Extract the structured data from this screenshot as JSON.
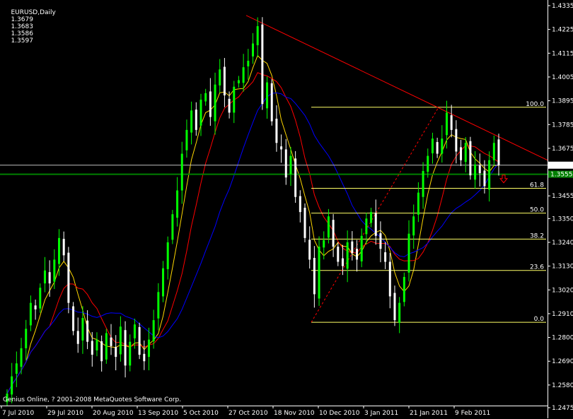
{
  "header": {
    "symbol": "EURUSD,Daily",
    "open": "1.3679",
    "high": "1.3683",
    "low": "1.3586",
    "close": "1.3597"
  },
  "footer": "Genius Online, ? 2001-2008 MetaQuotes Software Corp.",
  "colors": {
    "background": "#000000",
    "bull": "#00ff00",
    "bear": "#ffffff",
    "ma_fast": "#ffd700",
    "ma_mid": "#ff0000",
    "ma_slow": "#0000ff",
    "trendline": "#ff0000",
    "fib": "#ffff66",
    "green_level": "#008000",
    "current_price_line": "#c0c0c0"
  },
  "price_axis_labels": [
    "1.4335",
    "1.4225",
    "1.4115",
    "1.4005",
    "1.3895",
    "1.3785",
    "1.3675",
    "1.3455",
    "1.3350",
    "1.3240",
    "1.3130",
    "1.3020",
    "1.2910",
    "1.2800",
    "1.2690",
    "1.2580",
    "1.2475"
  ],
  "current_price_tag": "1.3597",
  "green_level_tag": "1.3555",
  "time_axis_labels": [
    "7 Jul 2010",
    "29 Jul 2010",
    "20 Aug 2010",
    "13 Sep 2010",
    "5 Oct 2010",
    "27 Oct 2010",
    "18 Nov 2010",
    "10 Dec 2010",
    "3 Jan 2011",
    "21 Jan 2011",
    "9 Feb 2011"
  ],
  "fib_levels": [
    {
      "label": "100.0",
      "price": 1.3865
    },
    {
      "label": "61.8",
      "price": 1.349
    },
    {
      "label": "50.0",
      "price": 1.3375
    },
    {
      "label": "38.2",
      "price": 1.3255
    },
    {
      "label": "23.6",
      "price": 1.311
    },
    {
      "label": "0.0",
      "price": 1.287
    }
  ],
  "chart_data": {
    "type": "candlestick",
    "symbol": "EURUSD",
    "timeframe": "Daily",
    "ylim": [
      1.2475,
      1.4335
    ],
    "green_level": 1.3555,
    "current_price": 1.3597,
    "close_series": [
      1.254,
      1.262,
      1.268,
      1.275,
      1.284,
      1.296,
      1.293,
      1.303,
      1.311,
      1.305,
      1.316,
      1.326,
      1.318,
      1.296,
      1.283,
      1.277,
      1.289,
      1.278,
      1.272,
      1.279,
      1.269,
      1.282,
      1.276,
      1.271,
      1.285,
      1.267,
      1.278,
      1.286,
      1.272,
      1.269,
      1.279,
      1.288,
      1.301,
      1.312,
      1.324,
      1.337,
      1.348,
      1.365,
      1.376,
      1.385,
      1.376,
      1.39,
      1.393,
      1.382,
      1.397,
      1.404,
      1.392,
      1.384,
      1.396,
      1.399,
      1.405,
      1.408,
      1.416,
      1.424,
      1.388,
      1.398,
      1.38,
      1.37,
      1.367,
      1.354,
      1.364,
      1.345,
      1.338,
      1.326,
      1.316,
      1.3,
      1.322,
      1.325,
      1.336,
      1.322,
      1.315,
      1.313,
      1.324,
      1.319,
      1.316,
      1.327,
      1.335,
      1.338,
      1.327,
      1.321,
      1.315,
      1.299,
      1.288,
      1.296,
      1.308,
      1.328,
      1.336,
      1.347,
      1.357,
      1.364,
      1.372,
      1.365,
      1.372,
      1.384,
      1.376,
      1.366,
      1.362,
      1.37,
      1.355,
      1.36,
      1.356,
      1.35,
      1.362,
      1.37,
      1.3597
    ]
  }
}
